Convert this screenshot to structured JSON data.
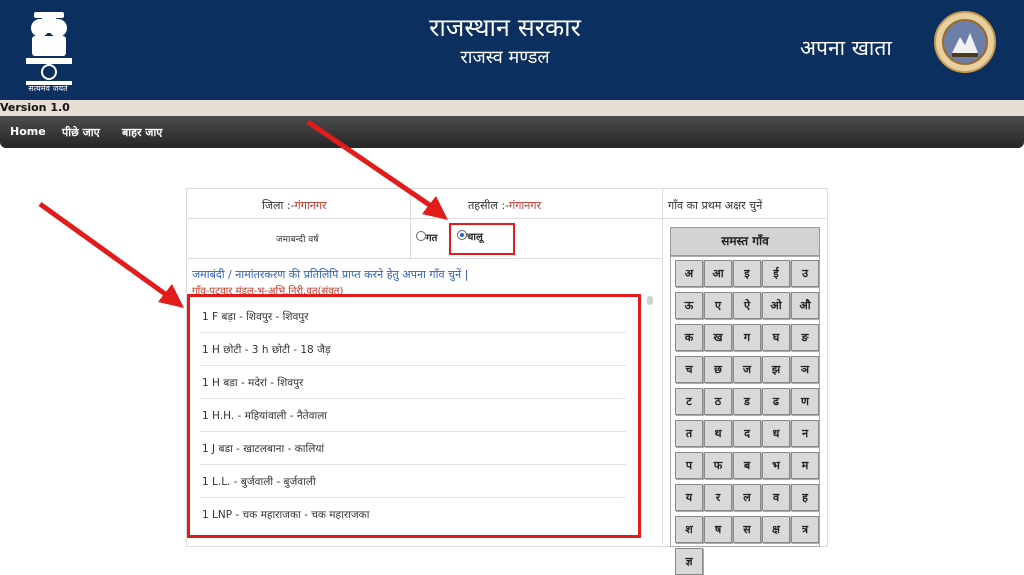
{
  "header": {
    "emblem_caption": "सत्यमेव जयते",
    "title": "राजस्थान सरकार",
    "subtitle": "राजस्व मण्डल",
    "app_name": "अपना खाता",
    "bg_color": "#0b2f5e"
  },
  "version": "Version 1.0",
  "nav": {
    "home": "Home",
    "back": "पीछे जाए",
    "exit": "बाहर जाए"
  },
  "form": {
    "district_label": "जिला :-",
    "district_value": "गंगानगर",
    "tehsil_label": "तहसील :-",
    "tehsil_value": "गंगानगर",
    "letter_prompt": "गाँव का प्रथम अक्षर चुनें",
    "year_label": "जमाबन्दी वर्ष",
    "opt_past": "गत",
    "opt_current": "चालू",
    "selected": "चालू",
    "instruction": "जमाबंदी / नामांतरकरण की प्रतिलिपि प्राप्त करने हेतु अपना गाँव चुनें |",
    "sub_instruction": "गाँव-पटवार मंडल-भू-अभि.निरी.वृत(संवत)"
  },
  "villages": [
    "1 F बड़ा - शिवपुर - शिवपुर",
    "1 H छोटी - 3 h छोटी - 18 जैड़",
    "1 H बडा - मदेरां - शिवपुर",
    "1 H.H. - महियांवाली - नैतेवाला",
    "1 J बडा - खाटलबाना - कालियां",
    "1 L.L. - बुर्जवाली - बुर्जवाली",
    "1 LNP - चक महाराजका - चक महाराजका"
  ],
  "letter_panel": {
    "all_label": "समस्त गाँव",
    "letters": [
      "अ",
      "आ",
      "इ",
      "ई",
      "उ",
      "ऊ",
      "ए",
      "ऐ",
      "ओ",
      "औ",
      "क",
      "ख",
      "ग",
      "घ",
      "ङ",
      "च",
      "छ",
      "ज",
      "झ",
      "ञ",
      "ट",
      "ठ",
      "ड",
      "ढ",
      "ण",
      "त",
      "थ",
      "द",
      "ध",
      "न",
      "प",
      "फ",
      "ब",
      "भ",
      "म",
      "य",
      "र",
      "ल",
      "व",
      "ह",
      "श",
      "ष",
      "स",
      "क्ष",
      "त्र",
      "ज्ञ"
    ]
  },
  "colors": {
    "highlight": "#e21b1b",
    "link": "#2b5fc2",
    "value": "#c0392b"
  }
}
